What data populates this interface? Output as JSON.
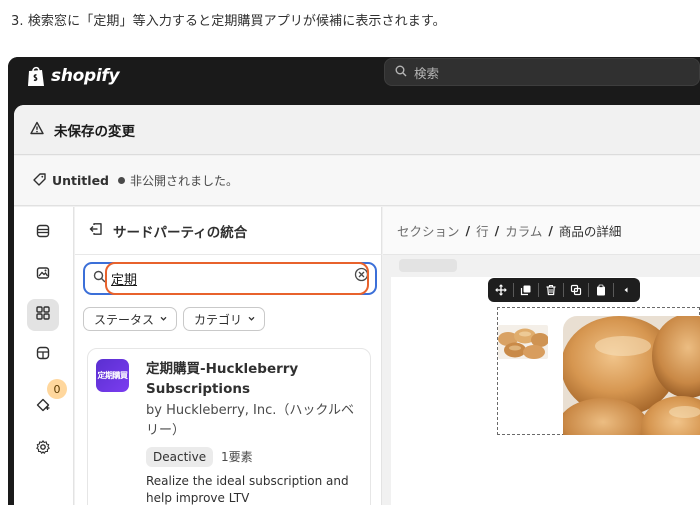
{
  "instruction": "3. 検索窓に「定期」等入力すると定期購買アプリが候補に表示されます。",
  "topbar": {
    "brand": "shopify",
    "search_placeholder": "検索"
  },
  "editor": {
    "unsaved_label": "未保存の変更",
    "page_title": "Untitled",
    "publish_status": "非公開されました。",
    "rail_badge_count": "0"
  },
  "sidebar": {
    "title": "サードパーティの統合",
    "search_value": "定期",
    "filters": [
      {
        "label": "ステータス"
      },
      {
        "label": "カテゴリ"
      }
    ],
    "app": {
      "icon_text": "定期購買",
      "name": "定期購買-Huckleberry Subscriptions",
      "developer": "by Huckleberry, Inc.（ハックルベリー）",
      "status": "Deactive",
      "element_count": "1要素",
      "description": "Realize the ideal subscription and help improve LTV"
    }
  },
  "canvas": {
    "breadcrumb": [
      "セクション",
      "行",
      "カラム",
      "商品の詳細"
    ],
    "separator": "/"
  },
  "colors": {
    "focus_ring": "#3b6fd8",
    "highlight": "#e8622c",
    "badge": "#ffd79d",
    "app_icon": "#5a2fd0"
  }
}
